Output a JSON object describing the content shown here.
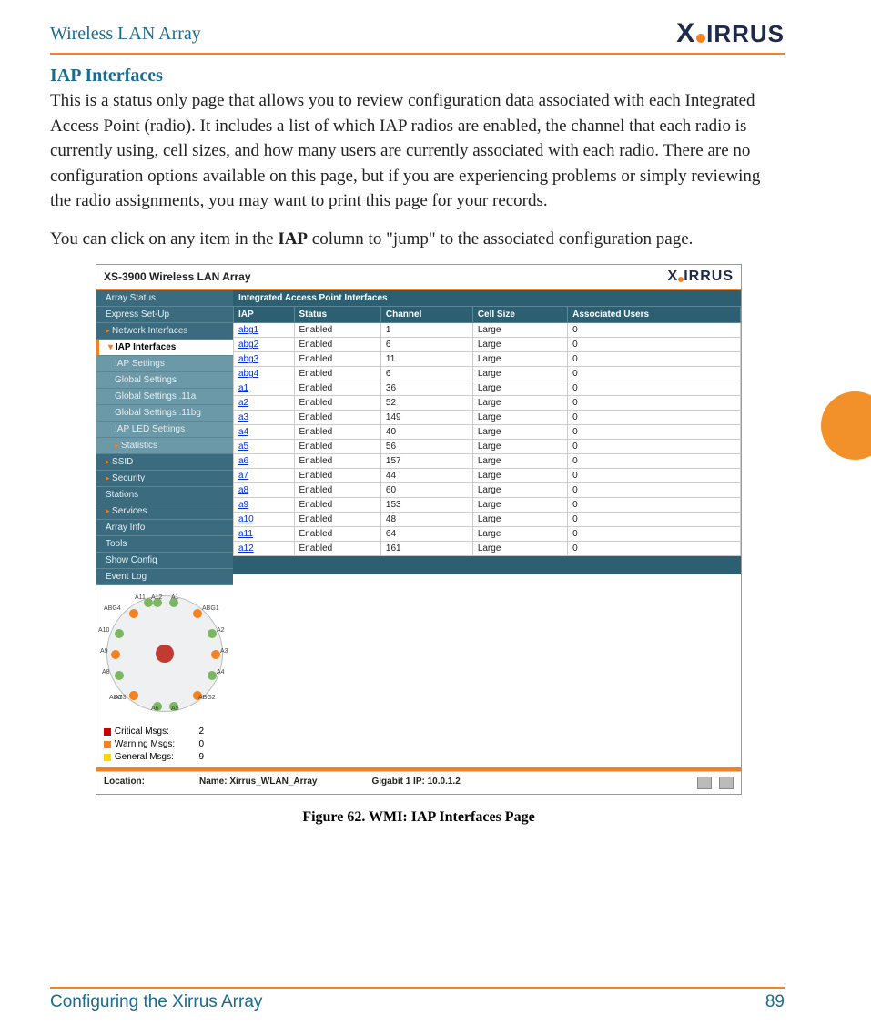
{
  "header": {
    "doc_title": "Wireless LAN Array",
    "brand": "XIRRUS"
  },
  "section": {
    "heading": "IAP Interfaces",
    "p1": "This is a status only page that allows you to review configuration data associated with each Integrated Access Point (radio). It includes a list of which IAP radios are enabled, the channel that each radio is currently using, cell sizes, and how many users are currently associated with each radio. There are no configuration options available on this page, but if you are experiencing problems or simply reviewing the radio assignments, you may want to print this page for your records.",
    "p2a": "You can click on any item in the ",
    "p2b": "IAP",
    "p2c": " column to \"jump\" to the associated configuration page."
  },
  "screenshot": {
    "product": "XS-3900 Wireless LAN Array",
    "brand": "XIRRUS",
    "nav": {
      "items": [
        "Array Status",
        "Express Set-Up",
        "Network Interfaces",
        "IAP Interfaces",
        "IAP Settings",
        "Global Settings",
        "Global Settings .11a",
        "Global Settings .11bg",
        "IAP LED Settings",
        "Statistics",
        "SSID",
        "Security",
        "Stations",
        "Services",
        "Array Info",
        "Tools",
        "Show Config",
        "Event Log"
      ]
    },
    "wheel_labels": [
      "A12",
      "A1",
      "ABG1",
      "A2",
      "A3",
      "A4",
      "ABG2",
      "A5",
      "A6",
      "A7",
      "ABG3",
      "A8",
      "A9",
      "A10",
      "ABG4",
      "A11"
    ],
    "msgs": {
      "critical": {
        "label": "Critical Msgs:",
        "value": "2"
      },
      "warning": {
        "label": "Warning Msgs:",
        "value": "0"
      },
      "general": {
        "label": "General Msgs:",
        "value": "9"
      }
    },
    "table": {
      "title": "Integrated Access Point Interfaces",
      "cols": [
        "IAP",
        "Status",
        "Channel",
        "Cell Size",
        "Associated Users"
      ],
      "rows": [
        {
          "iap": "abg1",
          "status": "Enabled",
          "channel": "1",
          "cell": "Large",
          "users": "0"
        },
        {
          "iap": "abg2",
          "status": "Enabled",
          "channel": "6",
          "cell": "Large",
          "users": "0"
        },
        {
          "iap": "abg3",
          "status": "Enabled",
          "channel": "11",
          "cell": "Large",
          "users": "0"
        },
        {
          "iap": "abg4",
          "status": "Enabled",
          "channel": "6",
          "cell": "Large",
          "users": "0"
        },
        {
          "iap": "a1",
          "status": "Enabled",
          "channel": "36",
          "cell": "Large",
          "users": "0"
        },
        {
          "iap": "a2",
          "status": "Enabled",
          "channel": "52",
          "cell": "Large",
          "users": "0"
        },
        {
          "iap": "a3",
          "status": "Enabled",
          "channel": "149",
          "cell": "Large",
          "users": "0"
        },
        {
          "iap": "a4",
          "status": "Enabled",
          "channel": "40",
          "cell": "Large",
          "users": "0"
        },
        {
          "iap": "a5",
          "status": "Enabled",
          "channel": "56",
          "cell": "Large",
          "users": "0"
        },
        {
          "iap": "a6",
          "status": "Enabled",
          "channel": "157",
          "cell": "Large",
          "users": "0"
        },
        {
          "iap": "a7",
          "status": "Enabled",
          "channel": "44",
          "cell": "Large",
          "users": "0"
        },
        {
          "iap": "a8",
          "status": "Enabled",
          "channel": "60",
          "cell": "Large",
          "users": "0"
        },
        {
          "iap": "a9",
          "status": "Enabled",
          "channel": "153",
          "cell": "Large",
          "users": "0"
        },
        {
          "iap": "a10",
          "status": "Enabled",
          "channel": "48",
          "cell": "Large",
          "users": "0"
        },
        {
          "iap": "a11",
          "status": "Enabled",
          "channel": "64",
          "cell": "Large",
          "users": "0"
        },
        {
          "iap": "a12",
          "status": "Enabled",
          "channel": "161",
          "cell": "Large",
          "users": "0"
        }
      ]
    },
    "status": {
      "location_label": "Location:",
      "name": "Name: Xirrus_WLAN_Array",
      "ip": "Gigabit 1 IP: 10.0.1.2"
    }
  },
  "caption": "Figure 62. WMI: IAP Interfaces Page",
  "footer": {
    "text": "Configuring the Xirrus Array",
    "page": "89"
  }
}
